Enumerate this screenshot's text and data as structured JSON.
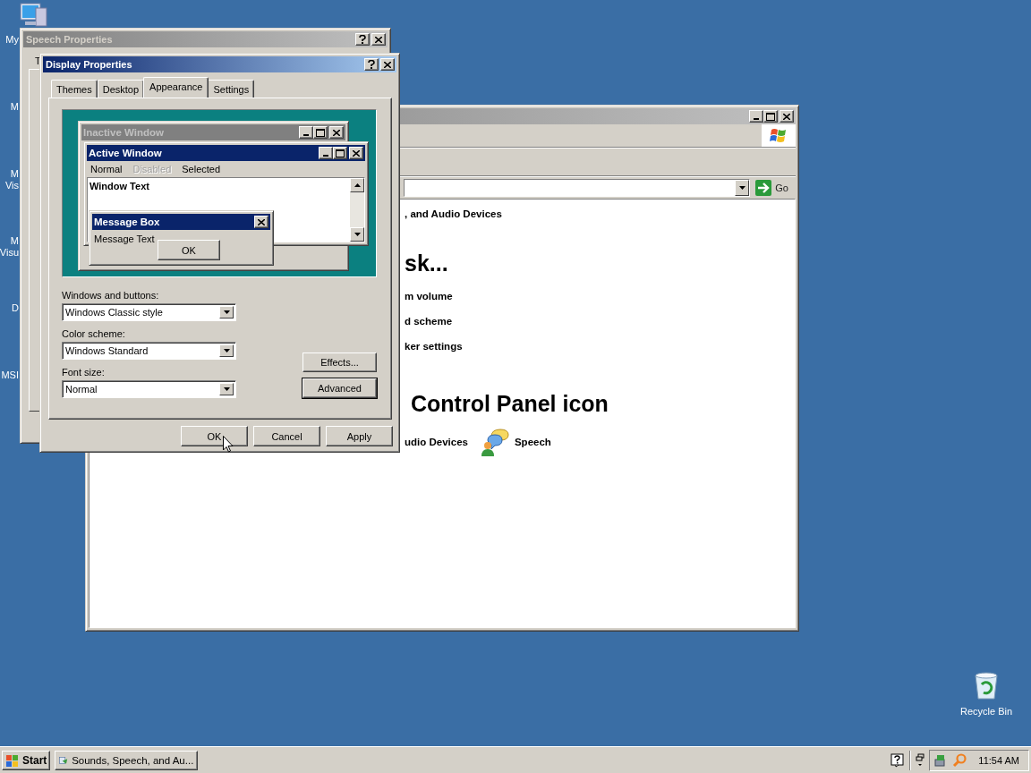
{
  "desktop_icons": [
    {
      "lines": [
        "My"
      ]
    },
    {
      "lines": [
        "M"
      ]
    },
    {
      "lines": [
        "M",
        "Vis"
      ]
    },
    {
      "lines": [
        "M",
        "Visu"
      ]
    },
    {
      "lines": [
        "D"
      ]
    },
    {
      "lines": [
        "MSI"
      ]
    }
  ],
  "recycle_bin": {
    "label": "Recycle Bin"
  },
  "control_panel": {
    "active": false,
    "go": "Go",
    "category": ", and Audio Devices",
    "task_heading": "sk...",
    "tasks": [
      "m volume",
      "d scheme",
      "ker settings"
    ],
    "icon_heading": "Control Panel icon",
    "icons": [
      {
        "kind": "text",
        "label": "udio Devices"
      },
      {
        "kind": "speech",
        "label": "Speech"
      }
    ]
  },
  "speech_window": {
    "title": "Speech Properties",
    "active": false,
    "tab_text": "T"
  },
  "display_window": {
    "title": "Display Properties",
    "active": true,
    "tabs": [
      {
        "label": "Themes",
        "selected": false
      },
      {
        "label": "Desktop",
        "selected": false
      },
      {
        "label": "Appearance",
        "selected": true
      },
      {
        "label": "Settings",
        "selected": false
      }
    ],
    "preview": {
      "inactive_title": "Inactive Window",
      "active_title": "Active Window",
      "menu": [
        {
          "label": "Normal",
          "disabled": false
        },
        {
          "label": "Disabled",
          "disabled": true
        },
        {
          "label": "Selected",
          "disabled": false
        }
      ],
      "window_text": "Window Text",
      "message_title": "Message Box",
      "message_text": "Message Text",
      "message_button": "OK"
    },
    "fields": [
      {
        "label": "Windows and buttons:",
        "value": "Windows Classic style"
      },
      {
        "label": "Color scheme:",
        "value": "Windows Standard"
      },
      {
        "label": "Font size:",
        "value": "Normal"
      }
    ],
    "side_buttons": [
      {
        "label": "Effects...",
        "focused": false
      },
      {
        "label": "Advanced",
        "focused": true
      }
    ],
    "buttons": [
      "OK",
      "Cancel",
      "Apply"
    ]
  },
  "taskbar": {
    "start": "Start",
    "tasks": [
      {
        "label": "Sounds, Speech, and Au...",
        "selected": false
      }
    ],
    "clock": "11:54 AM"
  }
}
